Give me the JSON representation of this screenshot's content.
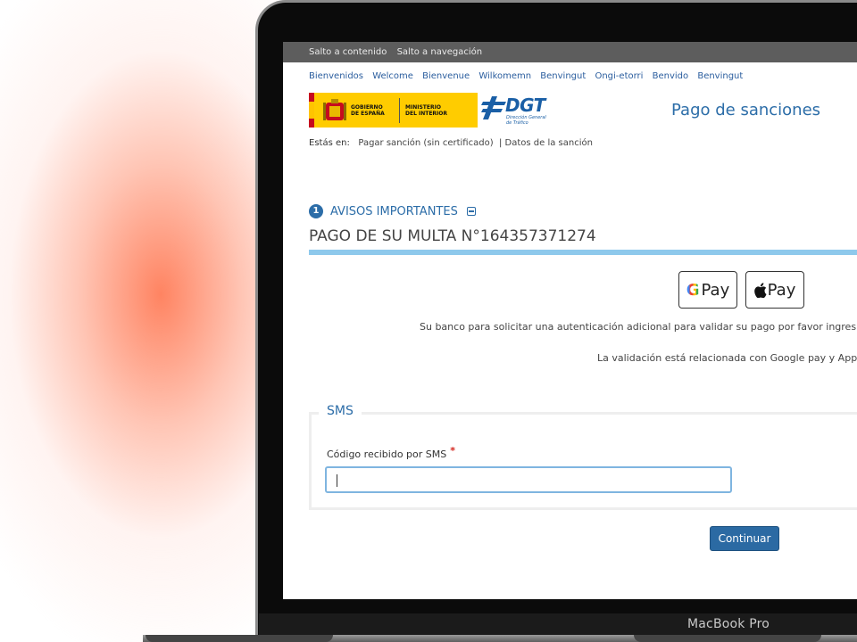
{
  "skip_links": [
    "Salto a contenido",
    "Salto a navegación"
  ],
  "languages": [
    "Bienvenidos",
    "Welcome",
    "Bienvenue",
    "Wilkomemn",
    "Benvingut",
    "Ongi-etorri",
    "Benvido",
    "Benvingut"
  ],
  "logos": {
    "gov_left": "GOBIERNO\nDE ESPAÑA",
    "gov_right": "MINISTERIO\nDEL INTERIOR",
    "dgt": "DGT",
    "dgt_sub": "Dirección General de Tráfico"
  },
  "header": {
    "title": "Pago de sanciones"
  },
  "breadcrumb": {
    "label": "Estás en:",
    "items": [
      "Pagar sanción (sin certificado)",
      "Datos de la sanción"
    ]
  },
  "notice": {
    "number": "1",
    "title": "AVISOS IMPORTANTES"
  },
  "fine": {
    "title": "PAGO DE SU MULTA N°164357371274"
  },
  "payment_buttons": {
    "google": "Pay",
    "apple": "Pay"
  },
  "messages": {
    "auth": "Su banco para solicitar una autenticación adicional para validar su pago por favor ingres",
    "validation": "La validación está relacionada con Google pay y App"
  },
  "sms_form": {
    "legend": "SMS",
    "label": "Código recibido por SMS",
    "required_mark": "*",
    "value": "",
    "placeholder": ""
  },
  "continue_button": "Continuar",
  "device": {
    "brand": "MacBook Pro"
  },
  "colors": {
    "accent": "#2c6da8",
    "bar": "#8ec9ec",
    "button": "#2b6aa3"
  }
}
